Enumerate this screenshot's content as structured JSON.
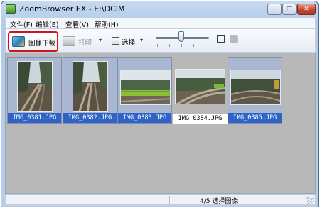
{
  "window": {
    "title": "ZoomBrowser EX - E:\\DCIM",
    "controls": {
      "minimize": "–",
      "maximize": "□",
      "close": "✕"
    }
  },
  "menu": [
    {
      "label": "文件(F)"
    },
    {
      "label": "编辑(E)"
    },
    {
      "label": "查看(V)"
    },
    {
      "label": "帮助(H)"
    }
  ],
  "toolbar": {
    "download_label": "图像下载",
    "print_label": "打印",
    "select_label": "选择",
    "dropdown_glyph": "▾",
    "icons": {
      "download": "camera-download-icon",
      "print": "printer-icon",
      "select": "select-icon",
      "fit": "fit-to-window-icon",
      "hand": "hand-icon"
    },
    "zoom_slider_value": 0.5
  },
  "thumbnails": [
    {
      "filename": "IMG_0381.JPG",
      "selected": true
    },
    {
      "filename": "IMG_0382.JPG",
      "selected": true
    },
    {
      "filename": "IMG_0383.JPG",
      "selected": true
    },
    {
      "filename": "IMG_0384.JPG",
      "selected": false
    },
    {
      "filename": "IMG_0385.JPG",
      "selected": true
    }
  ],
  "status": {
    "text": "4/5 选择图像"
  },
  "colors": {
    "selection_label_bg": "#2f63c6",
    "highlight_border": "#d0141d",
    "content_bg": "#b8b8b8"
  }
}
